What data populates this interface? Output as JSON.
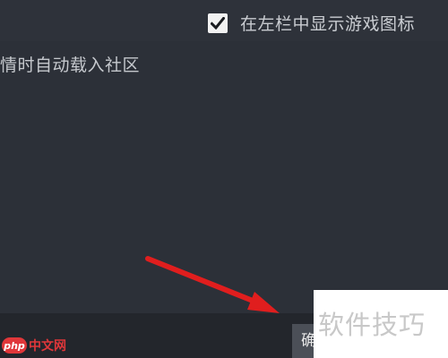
{
  "settings": {
    "show_game_icons_label": "在左栏中显示游戏图标",
    "show_game_icons_checked": true,
    "auto_load_community_label": "情时自动载入社区"
  },
  "footer": {
    "confirm_label": "确"
  },
  "watermark": {
    "text": "软件技巧",
    "logo_badge": "php",
    "logo_text": "中文网"
  },
  "colors": {
    "background": "#2c3038",
    "arrow": "#e01e1e",
    "logo": "#e0373a"
  },
  "icons": {
    "checkbox": "checkmark-icon",
    "annotation": "red-arrow-icon"
  }
}
